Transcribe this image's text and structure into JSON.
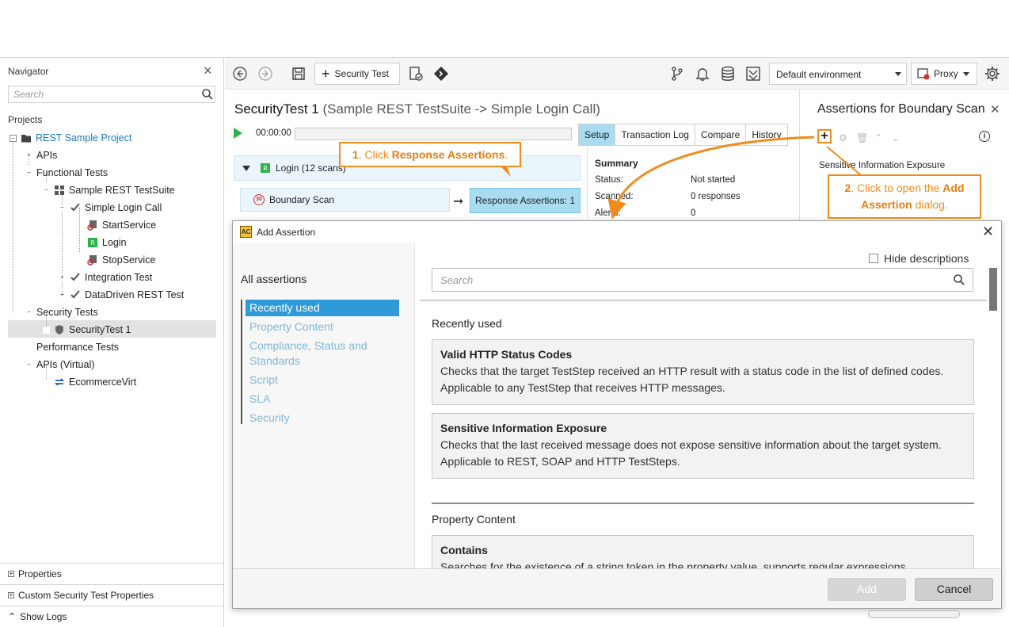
{
  "navigator": {
    "title": "Navigator",
    "search_placeholder": "Search",
    "projects_label": "Projects",
    "tree": [
      {
        "label": "REST Sample Project",
        "style": "project"
      },
      {
        "label": "APIs"
      },
      {
        "label": "Functional Tests"
      },
      {
        "label": "Sample REST TestSuite"
      },
      {
        "label": "Simple Login Call"
      },
      {
        "label": "StartService"
      },
      {
        "label": "Login"
      },
      {
        "label": "StopService"
      },
      {
        "label": "Integration Test"
      },
      {
        "label": "DataDriven REST Test"
      },
      {
        "label": "Security Tests"
      },
      {
        "label": "SecurityTest 1",
        "selected": true
      },
      {
        "label": "Performance Tests"
      },
      {
        "label": "APIs (Virtual)"
      },
      {
        "label": "EcommerceVirt"
      }
    ],
    "bottom": {
      "properties": "Properties",
      "custom_props": "Custom Security Test Properties",
      "show_logs": "Show Logs"
    }
  },
  "toolbar": {
    "security_test_btn": "Security Test",
    "environment": "Default environment",
    "proxy": "Proxy"
  },
  "editor": {
    "title": "SecurityTest 1",
    "subtitle": "(Sample REST TestSuite -> Simple Login Call)",
    "timer": "00:00:00",
    "tabs": [
      "Setup",
      "Transaction Log",
      "Compare",
      "History"
    ],
    "scan_header": "Login (12 scans)",
    "scan_row": "Boundary Scan",
    "scan_badge": "30",
    "response_assertions": "Response Assertions: 1",
    "summary": {
      "title": "Summary",
      "status_label": "Status:",
      "status_value": "Not started",
      "scanned_label": "Scanned:",
      "scanned_value": "0 responses",
      "alerts_label": "Alerts:",
      "alerts_value": "0"
    }
  },
  "assertions_panel": {
    "title": "Assertions for Boundary Scan",
    "item": "Sensitive Information Exposure"
  },
  "callouts": {
    "c1_prefix": "1",
    "c1_text": ". Click ",
    "c1_bold": "Response Assertions",
    "c1_end": ".",
    "c2_prefix": "2",
    "c2_text": ". Click to open the ",
    "c2_bold": "Add Assertion",
    "c2_end": " dialog."
  },
  "dialog": {
    "title": "Add Assertion",
    "hide_descriptions": "Hide descriptions",
    "search_placeholder": "Search",
    "all_assertions": "All assertions",
    "categories": [
      "Recently used",
      "Property Content",
      "Compliance, Status and Standards",
      "Script",
      "SLA",
      "Security"
    ],
    "sections": [
      {
        "title": "Recently used",
        "cards": [
          {
            "name": "Valid HTTP Status Codes",
            "desc": "Checks that the target TestStep received an HTTP result with a status code in the list of defined codes. Applicable to any TestStep that receives HTTP messages."
          },
          {
            "name": "Sensitive Information Exposure",
            "desc": "Checks that the last received message does not expose sensitive information about the target system. Applicable to REST, SOAP and HTTP TestSteps."
          }
        ]
      },
      {
        "title": "Property Content",
        "cards": [
          {
            "name": "Contains",
            "desc": "Searches for the existence of a string token in the property value, supports regular expressions."
          }
        ]
      }
    ],
    "add_button": "Add",
    "cancel_button": "Cancel"
  },
  "colors": {
    "accent_orange": "#f08c1e",
    "tab_active": "#a9dbf1",
    "category_active": "#2e9ad8",
    "category_link": "#7fb8d8",
    "project_blue": "#1a7bbf"
  }
}
